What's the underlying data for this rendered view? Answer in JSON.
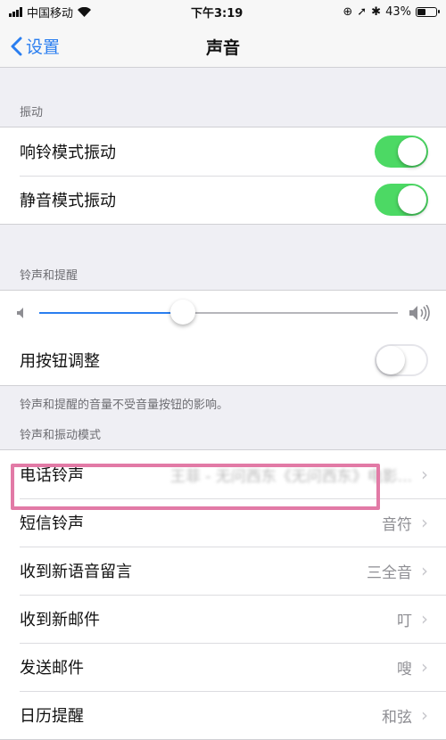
{
  "status_bar": {
    "carrier": "中国移动",
    "time": "下午3:19",
    "battery": "43%"
  },
  "nav": {
    "back_label": "设置",
    "title": "声音"
  },
  "vibration": {
    "header": "振动",
    "items": [
      {
        "label": "响铃模式振动",
        "on": true
      },
      {
        "label": "静音模式振动",
        "on": true
      }
    ]
  },
  "ringer": {
    "header": "铃声和提醒",
    "volume_level": 0.4,
    "change_with_buttons_label": "用按钮调整",
    "change_with_buttons_on": false,
    "footer": "铃声和提醒的音量不受音量按钮的影响。"
  },
  "patterns": {
    "header": "铃声和振动模式",
    "items": [
      {
        "label": "电话铃声",
        "value": "王菲 - 无问西东《无问西东》电影..."
      },
      {
        "label": "短信铃声",
        "value": "音符"
      },
      {
        "label": "收到新语音留言",
        "value": "三全音"
      },
      {
        "label": "收到新邮件",
        "value": "叮"
      },
      {
        "label": "发送邮件",
        "value": "嗖"
      },
      {
        "label": "日历提醒",
        "value": "和弦"
      }
    ]
  },
  "colors": {
    "accent": "#2a7ef0",
    "toggle_on": "#4cd964",
    "highlight": "#e27aa6"
  }
}
